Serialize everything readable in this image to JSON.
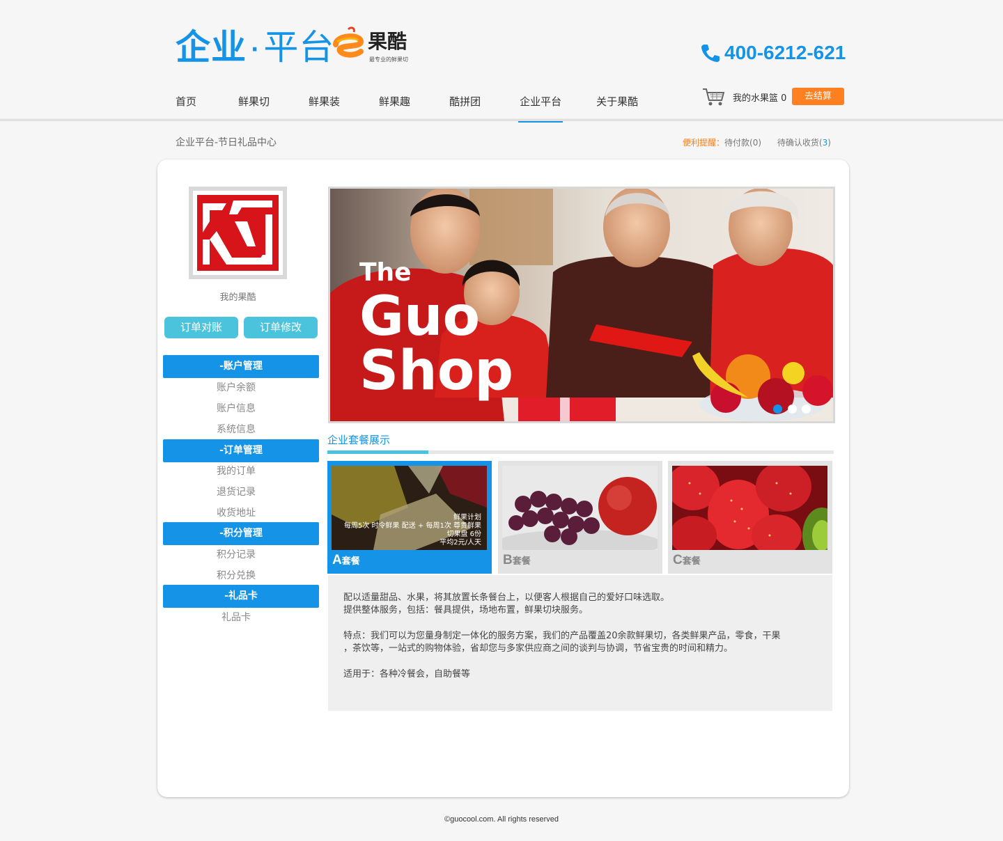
{
  "header": {
    "logo_left": "企业",
    "logo_right": "平台",
    "brand_name": "果酷",
    "brand_slogan": "最专业的鲜果切",
    "hotline": "400-6212-621"
  },
  "nav": {
    "items": [
      "首页",
      "鲜果切",
      "鲜果装",
      "鲜果趣",
      "酷拼团",
      "企业平台",
      "关于果酷"
    ],
    "active_index": 5
  },
  "cart": {
    "label": "我的水果篮 0",
    "checkout": "去结算"
  },
  "breadcrumb": "企业平台-节日礼品中心",
  "reminder": {
    "label": "便利提醒：",
    "pending_payment": "待付款(0)",
    "pending_receipt_label": "待确认收货(",
    "pending_receipt_count": "3",
    "pending_receipt_close": ")"
  },
  "sidebar": {
    "profile_label": "我的果酷",
    "btn_reconcile": "订单对账",
    "btn_modify": "订单修改",
    "sections": [
      {
        "title": "-账户管理",
        "items": [
          "账户余额",
          "账户信息",
          "系统信息"
        ]
      },
      {
        "title": "-订单管理",
        "items": [
          "我的订单",
          "退货记录",
          "收货地址"
        ]
      },
      {
        "title": "-积分管理",
        "items": [
          "积分记录",
          "积分兑换"
        ]
      },
      {
        "title": "-礼品卡",
        "items": [
          "礼品卡"
        ]
      }
    ]
  },
  "banner": {
    "line1": "The",
    "line2": "Guo",
    "line3": "Shop",
    "active_dot": 0,
    "dot_count": 3
  },
  "packages": {
    "title": "企业套餐展示",
    "items": [
      {
        "letter": "A",
        "suffix": "套餐",
        "active": true,
        "overlay": [
          "鲜果计划",
          "每周5次 时令鲜果 配送 + 每周1次 尊贵鲜果",
          "切果盘 6份",
          "平均2元/人天"
        ]
      },
      {
        "letter": "B",
        "suffix": "套餐",
        "active": false
      },
      {
        "letter": "C",
        "suffix": "套餐",
        "active": false
      }
    ],
    "description": [
      "配以适量甜品、水果，将其放置长条餐台上，以便客人根据自己的爱好口味选取。",
      "提供整体服务，包括：餐具提供，场地布置，鲜果切块服务。",
      "",
      "特点：我们可以为您量身制定一体化的服务方案，我们的产品覆盖20余款鲜果切，各类鲜果产品，零食，干果",
      "，茶饮等，一站式的购物体验，省却您与多家供应商之间的谈判与协调，节省宝贵的时间和精力。",
      "",
      "适用于：各种冷餐会，自助餐等"
    ]
  },
  "footer": "©guocool.com. All rights reserved",
  "colors": {
    "accent": "#1593e6",
    "orange": "#ff8020",
    "teal": "#4cc3dc"
  }
}
